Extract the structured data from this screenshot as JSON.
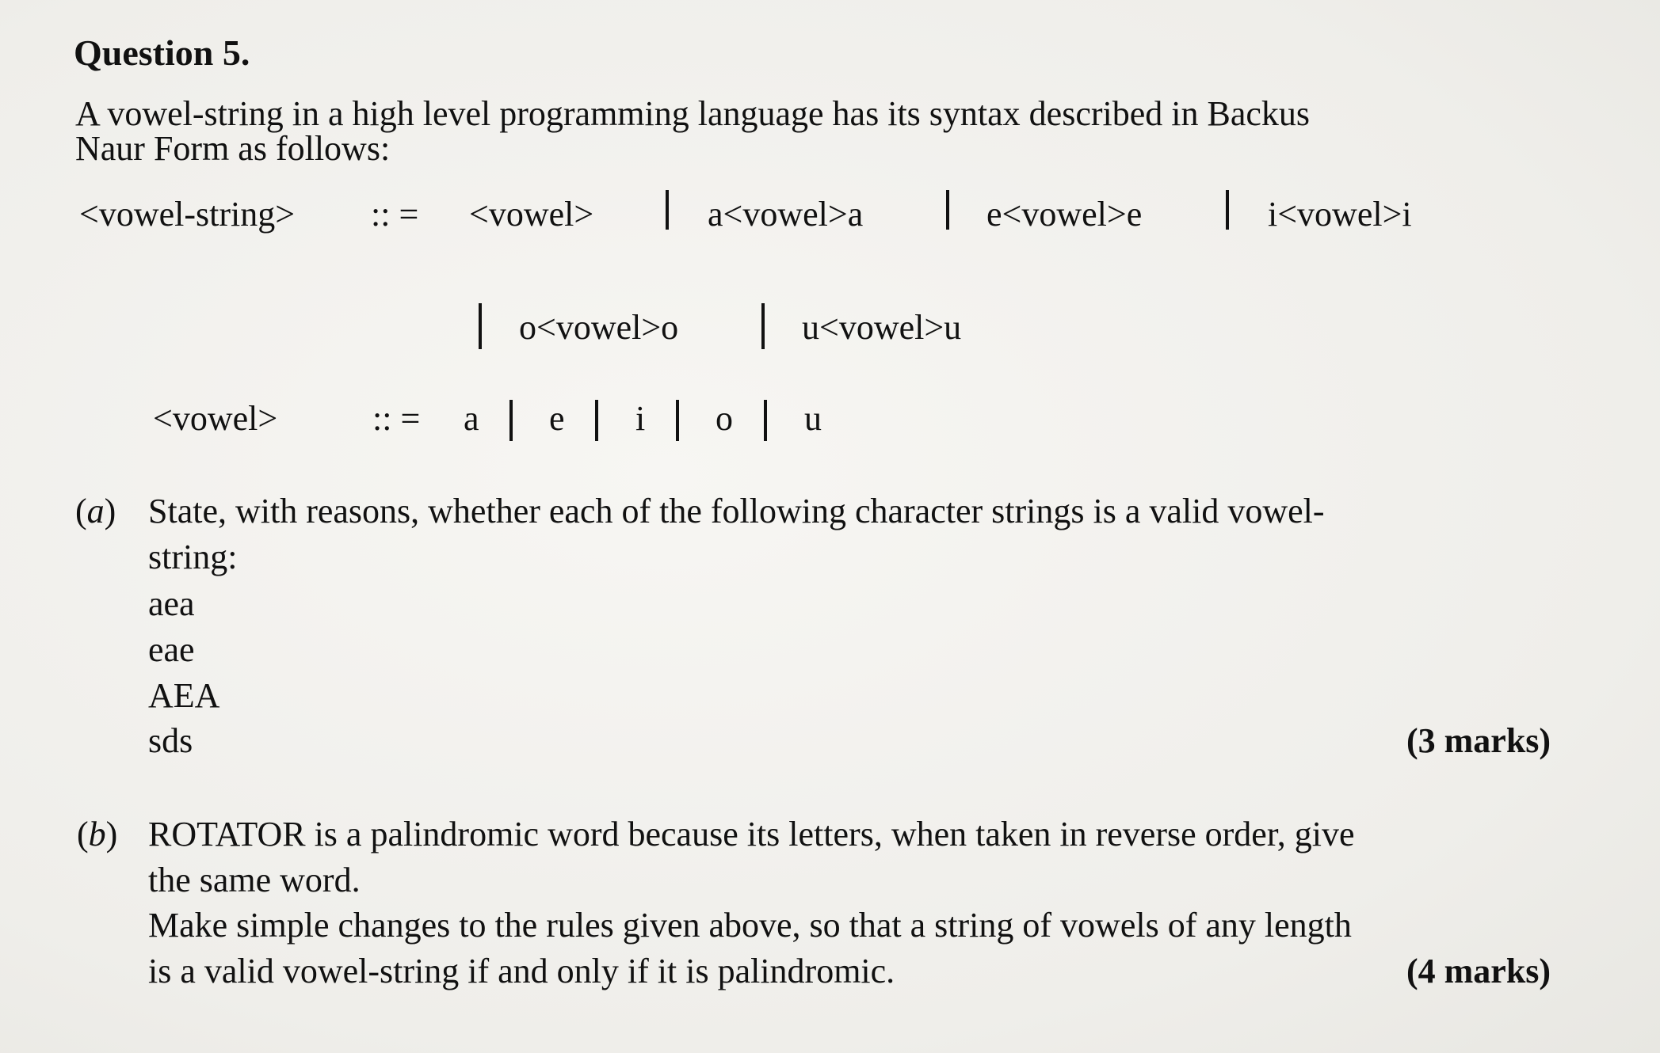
{
  "question": {
    "title": "Question 5.",
    "intro_line1": "A vowel-string in a high level programming language has its syntax described in Backus",
    "intro_line2": "Naur Form as follows:"
  },
  "bnf": {
    "rule1": {
      "lhs": "<vowel-string>",
      "op": ":: =",
      "alt1": "<vowel>",
      "alt2": "a<vowel>a",
      "alt3": "e<vowel>e",
      "alt4": "i<vowel>i",
      "alt5": "o<vowel>o",
      "alt6": "u<vowel>u"
    },
    "rule2": {
      "lhs": "<vowel>",
      "op": ":: =",
      "alts": [
        "a",
        "e",
        "i",
        "o",
        "u"
      ]
    }
  },
  "part_a": {
    "label_open": "(",
    "label_letter": "a",
    "label_close": ")",
    "text_line1": "State, with reasons, whether each of the following character strings is a valid vowel-",
    "text_line2": "string:",
    "strings": [
      "aea",
      "eae",
      "AEA",
      "sds"
    ],
    "marks": "(3 marks)"
  },
  "part_b": {
    "label_open": "(",
    "label_letter": "b",
    "label_close": ")",
    "text_line1": "ROTATOR is a palindromic word because its letters, when taken in reverse order, give",
    "text_line2": "the same word.",
    "text_line3": "Make simple changes to the rules given above, so that a string of vowels of any length",
    "text_line4": "is a valid vowel-string if and only if it is palindromic.",
    "marks": "(4 marks)"
  }
}
